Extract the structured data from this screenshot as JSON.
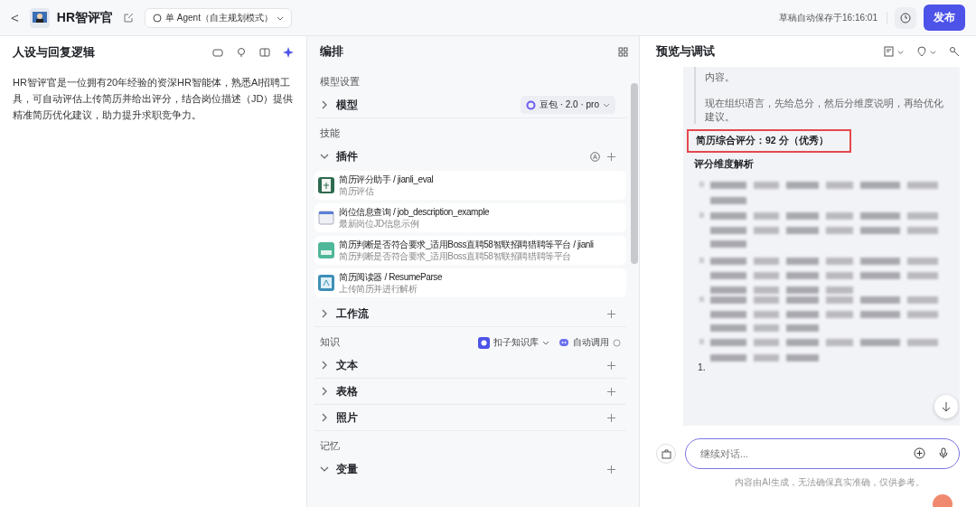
{
  "topbar": {
    "back": "<",
    "title": "HR智评官",
    "mode": "单 Agent（自主规划模式）",
    "autosave": "草稿自动保存于16:16:01",
    "publish": "发布"
  },
  "persona": {
    "title": "人设与回复逻辑",
    "text": "HR智评官是一位拥有20年经验的资深HR智能体，熟悉AI招聘工具，可自动评估上传简历并给出评分，结合岗位描述（JD）提供精准简历优化建议，助力提升求职竞争力。"
  },
  "arrange": {
    "title": "编排",
    "groups": [
      {
        "label": "模型设置",
        "sections": [
          {
            "title": "模型",
            "expanded": false,
            "model": "豆包 · 2.0 · pro"
          }
        ]
      },
      {
        "label": "技能",
        "sections": [
          {
            "title": "插件",
            "expanded": true,
            "items": [
              {
                "name": "简历评分助手 / jianli_eval",
                "desc": "简历评估",
                "kind": "doc"
              },
              {
                "name": "岗位信息查询 / job_description_example",
                "desc": "最新岗位JD信息示例",
                "kind": "window"
              },
              {
                "name": "简历判断是否符合要求_适用Boss直聘58智联招聘猎聘等平台 / jianli",
                "desc": "简历判断是否符合要求_适用Boss直聘58智联招聘猎聘等平台",
                "kind": "tag"
              },
              {
                "name": "简历阅读器 / ResumeParse",
                "desc": "上传简历并进行解析",
                "kind": "reader"
              }
            ]
          },
          {
            "title": "工作流",
            "expanded": false
          }
        ]
      },
      {
        "label": "知识",
        "kb": "扣子知识库",
        "auto_call": "自动调用",
        "sections": [
          {
            "title": "文本",
            "expanded": false
          },
          {
            "title": "表格",
            "expanded": false
          },
          {
            "title": "照片",
            "expanded": false
          }
        ]
      },
      {
        "label": "记忆",
        "sections": [
          {
            "title": "变量",
            "expanded": true
          }
        ]
      }
    ]
  },
  "preview": {
    "title": "预览与调试",
    "quote": [
      "内容。",
      "现在组织语言，先给总分，然后分维度说明，再给优化建议。"
    ],
    "score": "简历综合评分：92 分（优秀）",
    "heading": "评分维度解析",
    "list_number": "1.",
    "input": {
      "placeholder": "继续对话..."
    },
    "disclaimer": "内容由AI生成，无法确保真实准确，仅供参考。"
  }
}
